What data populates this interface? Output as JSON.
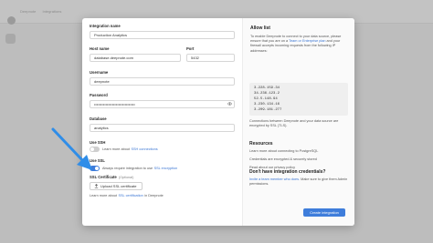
{
  "app": {
    "breadcrumb": [
      "Deepnote",
      "Integrations"
    ]
  },
  "form": {
    "integration_name": {
      "label": "Integration name",
      "value": "Production Analytics"
    },
    "host_name": {
      "label": "Host name",
      "value": "database.deepnote.com"
    },
    "port": {
      "label": "Port",
      "value": "5432"
    },
    "username": {
      "label": "Username",
      "value": "deepnote"
    },
    "password": {
      "label": "Password",
      "value": "••••••••••••••••••••••••••••••••"
    },
    "database": {
      "label": "Database",
      "value": "analytics"
    },
    "ssh": {
      "title": "Use SSH",
      "text": "Learn more about",
      "link": "SSH connections"
    },
    "ssl": {
      "title": "Use SSL",
      "text": "Always require integration to use",
      "link": "SSL encryption",
      "cert_label": "SSL Certificate",
      "cert_optional": "(Optional)",
      "upload_label": "Upload SSL certificate",
      "learn_text": "Learn more about",
      "learn_link": "SSL certification",
      "learn_suffix": "in Deepnote"
    }
  },
  "allow_list": {
    "title": "Allow list",
    "text_1": "To enable Deepnote to connect to your data source, please ensure that you are on a",
    "text_link": "Team or Enterprise plan",
    "text_2": "and your firewall accepts incoming requests from the following IP addresses:",
    "ips": [
      "3.228.159.34",
      "34.236.123.2",
      "52.5.148.94",
      "3.230.134.16",
      "3.209.181.277"
    ],
    "footnote": "Connections between Deepnote and your data source are encrypted by SSL (TLS)."
  },
  "resources": {
    "title": "Resources",
    "links": [
      "Learn more about connecting to PostgreSQL",
      "Credentials are encrypted & securely stored",
      "Read about our privacy policy"
    ]
  },
  "no_credentials": {
    "title": "Don't have integration credentials?",
    "link": "Invite a team member who does.",
    "text": "Make sure to give them Admin permissions."
  },
  "create_button": "Create integration",
  "colors": {
    "accent": "#3e7ddb",
    "toggle_off": "#cfcfcf",
    "arrow": "#2f8de8"
  }
}
